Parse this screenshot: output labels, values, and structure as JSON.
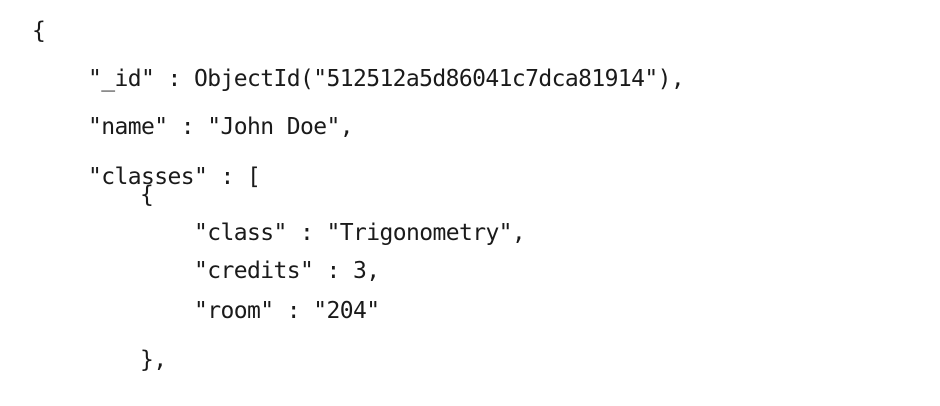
{
  "document": {
    "lines": [
      "{",
      "\"_id\" : ObjectId(\"512512a5d86041c7dca81914\"),",
      "\"name\" : \"John Doe\",",
      "\"classes\" : [",
      "{",
      "\"class\" : \"Trigonometry\",",
      "\"credits\" : 3,",
      "\"room\" : \"204\"",
      "},"
    ]
  }
}
